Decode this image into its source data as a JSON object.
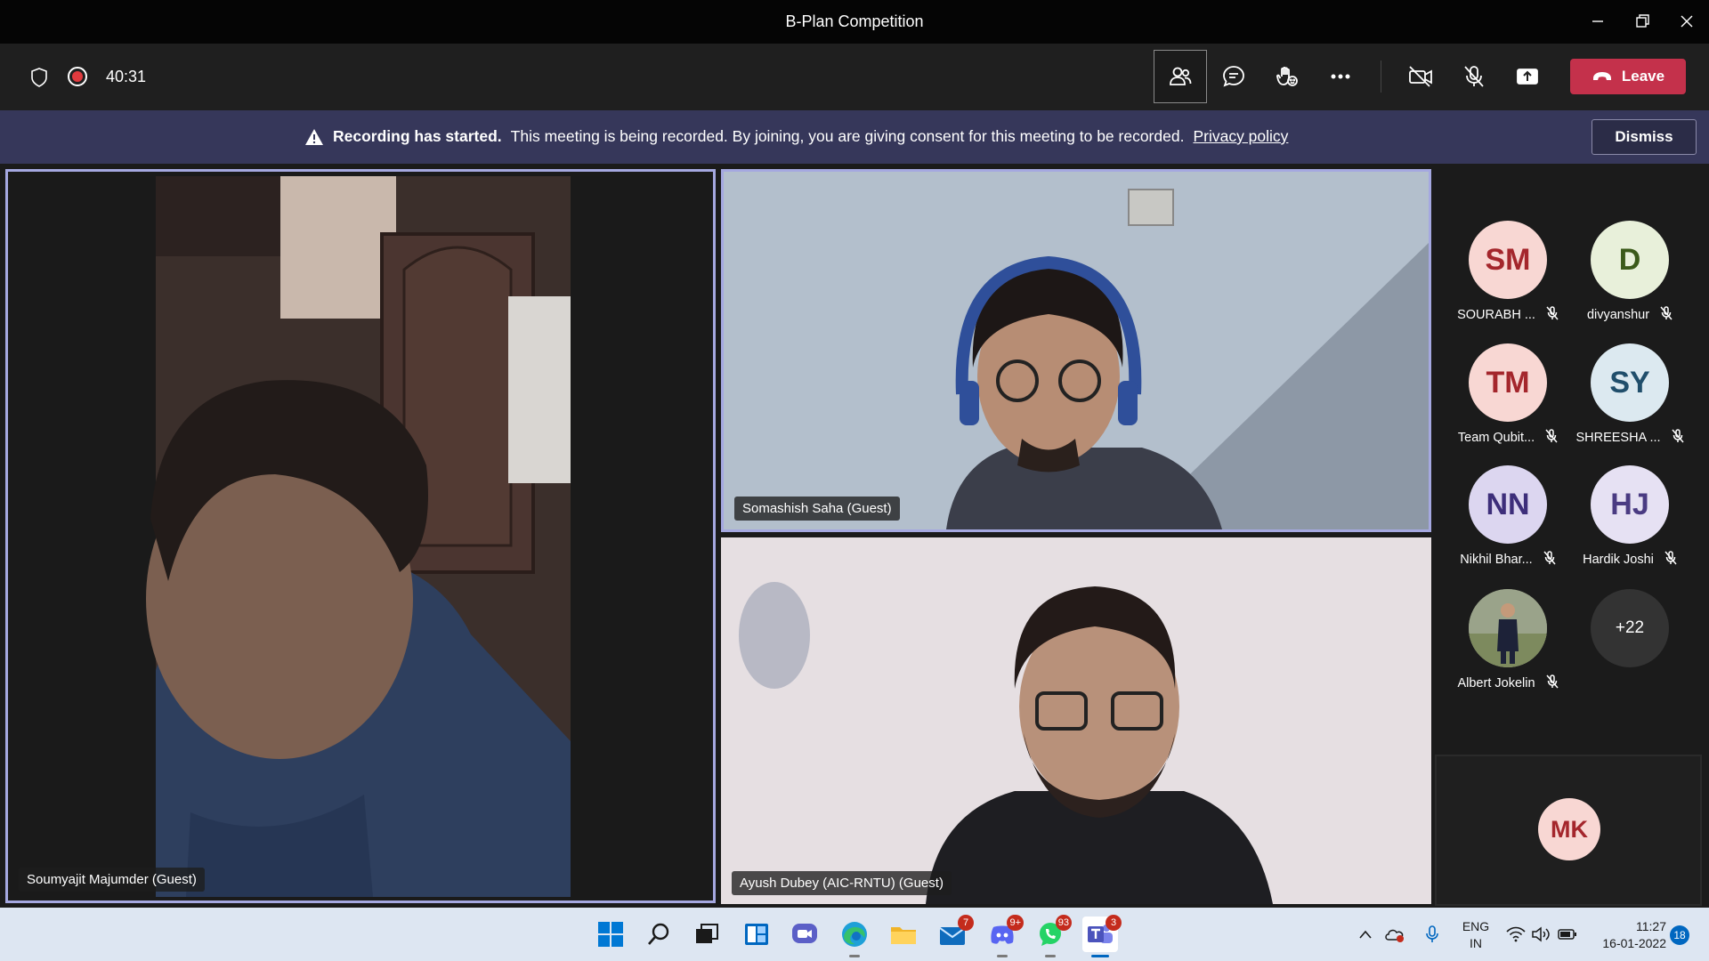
{
  "window": {
    "title": "B-Plan Competition"
  },
  "toolbar": {
    "timer": "40:31",
    "leave_label": "Leave"
  },
  "banner": {
    "title": "Recording has started.",
    "message": "This meeting is being recorded. By joining, you are giving consent for this meeting to be recorded.",
    "link": "Privacy policy",
    "dismiss_label": "Dismiss"
  },
  "videos": [
    {
      "name": "Soumyajit Majumder (Guest)"
    },
    {
      "name": "Somashish Saha (Guest)"
    },
    {
      "name": "Ayush Dubey (AIC-RNTU) (Guest)"
    }
  ],
  "participants": [
    {
      "initials": "SM",
      "name": "SOURABH ...",
      "bg": "#f8d7d3",
      "fg": "#a4262c"
    },
    {
      "initials": "D",
      "name": "divyanshur",
      "bg": "#e8f0da",
      "fg": "#3b5a1a"
    },
    {
      "initials": "TM",
      "name": "Team Qubit...",
      "bg": "#f8d7d3",
      "fg": "#a4262c"
    },
    {
      "initials": "SY",
      "name": "SHREESHA ...",
      "bg": "#dce9f0",
      "fg": "#204e6b"
    },
    {
      "initials": "NN",
      "name": "Nikhil Bhar...",
      "bg": "#dcd6f0",
      "fg": "#3d2e7a"
    },
    {
      "initials": "HJ",
      "name": "Hardik Joshi",
      "bg": "#e6e1f3",
      "fg": "#4a3b82"
    },
    {
      "initials": "",
      "name": "Albert Jokelin",
      "bg": "#8a9078",
      "fg": "#ffffff"
    },
    {
      "initials": "+22",
      "name": "",
      "bg": "#333333",
      "fg": "#ffffff"
    }
  ],
  "self": {
    "initials": "MK",
    "bg": "#f8d7d3",
    "fg": "#a4262c"
  },
  "taskbar": {
    "badges": {
      "mail": "7",
      "discord": "9+",
      "whatsapp": "93",
      "teams": "3"
    },
    "lang_top": "ENG",
    "lang_bottom": "IN",
    "time": "11:27",
    "date": "16-01-2022",
    "notifications": "18"
  },
  "colors": {
    "leave": "#c4314b",
    "banner": "#36375a",
    "speaking_border": "#a5a8e0",
    "taskbar": "#dde6f2"
  }
}
